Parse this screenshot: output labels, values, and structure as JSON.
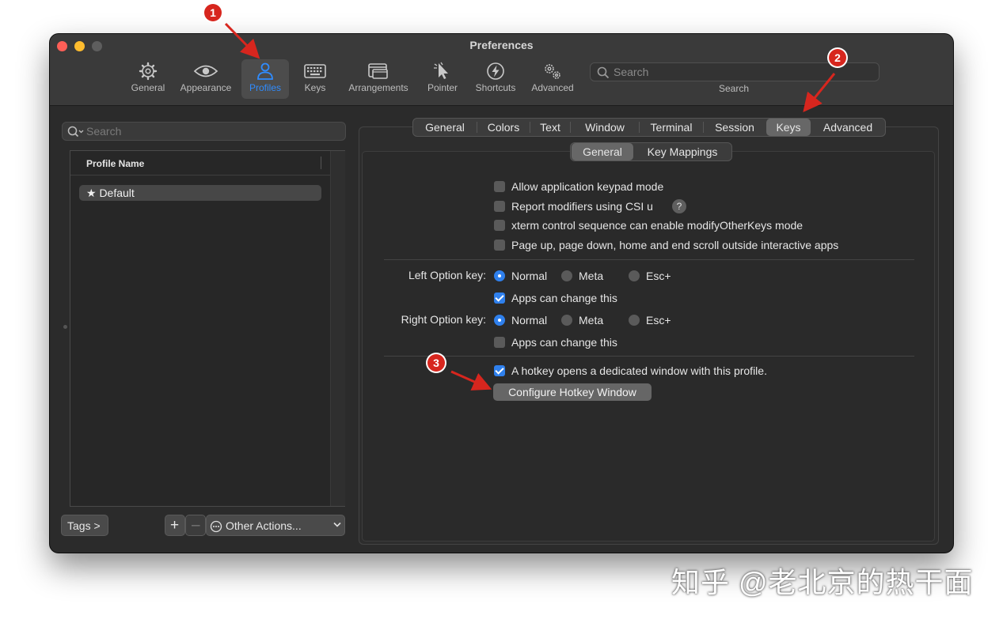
{
  "window": {
    "title": "Preferences"
  },
  "toolbar": {
    "items": [
      {
        "label": "General",
        "icon": "gear-icon"
      },
      {
        "label": "Appearance",
        "icon": "eye-icon"
      },
      {
        "label": "Profiles",
        "icon": "person-icon",
        "active": true
      },
      {
        "label": "Keys",
        "icon": "keyboard-icon"
      },
      {
        "label": "Arrangements",
        "icon": "windows-icon"
      },
      {
        "label": "Pointer",
        "icon": "pointer-icon"
      },
      {
        "label": "Shortcuts",
        "icon": "bolt-icon"
      },
      {
        "label": "Advanced",
        "icon": "gears-icon"
      }
    ],
    "search_placeholder": "Search",
    "search_caption": "Search",
    "active_color": "#2f8cff"
  },
  "profiles": {
    "search_placeholder": "Search",
    "column_header": "Profile Name",
    "rows": [
      {
        "label": "★ Default"
      }
    ],
    "tags_button": "Tags >",
    "add_button": "+",
    "remove_button": "–",
    "other_actions": "Other Actions..."
  },
  "tabs": {
    "items": [
      "General",
      "Colors",
      "Text",
      "Window",
      "Terminal",
      "Session",
      "Keys",
      "Advanced"
    ],
    "selected": "Keys"
  },
  "subtabs": {
    "items": [
      "General",
      "Key Mappings"
    ],
    "selected": "General"
  },
  "keys_general": {
    "options": [
      {
        "label": "Allow application keypad mode",
        "checked": false
      },
      {
        "label": "Report modifiers using CSI u",
        "checked": false,
        "help": "?"
      },
      {
        "label": "xterm control sequence can enable modifyOtherKeys mode",
        "checked": false
      },
      {
        "label": "Page up, page down, home and end scroll outside interactive apps",
        "checked": false
      }
    ],
    "left_option": {
      "label": "Left Option key:",
      "choices": [
        "Normal",
        "Meta",
        "Esc+"
      ],
      "selected": "Normal",
      "apps_can_change": {
        "label": "Apps can change this",
        "checked": true
      }
    },
    "right_option": {
      "label": "Right Option key:",
      "choices": [
        "Normal",
        "Meta",
        "Esc+"
      ],
      "selected": "Normal",
      "apps_can_change": {
        "label": "Apps can change this",
        "checked": false
      }
    },
    "hotkey": {
      "label": "A hotkey opens a dedicated window with this profile.",
      "checked": true
    },
    "configure_button": "Configure Hotkey Window"
  },
  "annotations": {
    "badges": [
      "1",
      "2",
      "3"
    ],
    "color": "#d7261e"
  },
  "watermark": "知乎 @老北京的热干面"
}
